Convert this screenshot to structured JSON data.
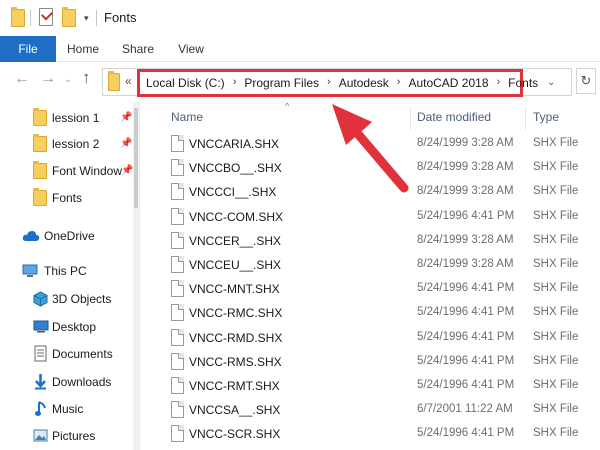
{
  "window": {
    "title": "Fonts",
    "quick_access_dropdown": "▾"
  },
  "ribbon": {
    "tabs": [
      "File",
      "Home",
      "Share",
      "View"
    ]
  },
  "nav": {
    "back": "←",
    "forward": "→",
    "recent": "⌄",
    "up": "↑",
    "overflow": "«",
    "breadcrumbs": [
      "Local Disk (C:)",
      "Program Files",
      "Autodesk",
      "AutoCAD 2018",
      "Fonts"
    ],
    "separator": "›",
    "dropdown": "⌄",
    "refresh": "↻"
  },
  "sidebar": {
    "items": [
      {
        "label": "lession 1",
        "icon": "folder-icon",
        "pinned": true
      },
      {
        "label": "lession 2",
        "icon": "folder-icon",
        "pinned": true
      },
      {
        "label": "Font Window",
        "icon": "folder-icon",
        "pinned": true
      },
      {
        "label": "Fonts",
        "icon": "folder-icon",
        "pinned": false
      },
      {
        "label": "OneDrive",
        "icon": "cloud-icon",
        "pinned": false
      },
      {
        "label": "This PC",
        "icon": "computer-icon",
        "pinned": false
      },
      {
        "label": "3D Objects",
        "icon": "cube-icon",
        "pinned": false
      },
      {
        "label": "Desktop",
        "icon": "desktop-icon",
        "pinned": false
      },
      {
        "label": "Documents",
        "icon": "document-icon",
        "pinned": false
      },
      {
        "label": "Downloads",
        "icon": "download-icon",
        "pinned": false
      },
      {
        "label": "Music",
        "icon": "music-icon",
        "pinned": false
      },
      {
        "label": "Pictures",
        "icon": "picture-icon",
        "pinned": false
      }
    ],
    "pin_glyph": "📌"
  },
  "list": {
    "columns": {
      "name": "Name",
      "date": "Date modified",
      "type": "Type"
    },
    "sort_indicator": "^",
    "rows": [
      {
        "name": "VNCCARIA.SHX",
        "date": "8/24/1999 3:28 AM",
        "type": "SHX File"
      },
      {
        "name": "VNCCBO__.SHX",
        "date": "8/24/1999 3:28 AM",
        "type": "SHX File"
      },
      {
        "name": "VNCCCI__.SHX",
        "date": "8/24/1999 3:28 AM",
        "type": "SHX File"
      },
      {
        "name": "VNCC-COM.SHX",
        "date": "5/24/1996 4:41 PM",
        "type": "SHX File"
      },
      {
        "name": "VNCCER__.SHX",
        "date": "8/24/1999 3:28 AM",
        "type": "SHX File"
      },
      {
        "name": "VNCCEU__.SHX",
        "date": "8/24/1999 3:28 AM",
        "type": "SHX File"
      },
      {
        "name": "VNCC-MNT.SHX",
        "date": "5/24/1996 4:41 PM",
        "type": "SHX File"
      },
      {
        "name": "VNCC-RMC.SHX",
        "date": "5/24/1996 4:41 PM",
        "type": "SHX File"
      },
      {
        "name": "VNCC-RMD.SHX",
        "date": "5/24/1996 4:41 PM",
        "type": "SHX File"
      },
      {
        "name": "VNCC-RMS.SHX",
        "date": "5/24/1996 4:41 PM",
        "type": "SHX File"
      },
      {
        "name": "VNCC-RMT.SHX",
        "date": "5/24/1996 4:41 PM",
        "type": "SHX File"
      },
      {
        "name": "VNCCSA__.SHX",
        "date": "6/7/2001 11:22 AM",
        "type": "SHX File"
      },
      {
        "name": "VNCC-SCR.SHX",
        "date": "5/24/1996 4:41 PM",
        "type": "SHX File"
      }
    ]
  },
  "colors": {
    "file_tab": "#1e6fc4",
    "highlight": "#e0323a",
    "folder": "#f6cf5c",
    "column_header": "#4c607a",
    "meta_text": "#6d6d6d"
  }
}
